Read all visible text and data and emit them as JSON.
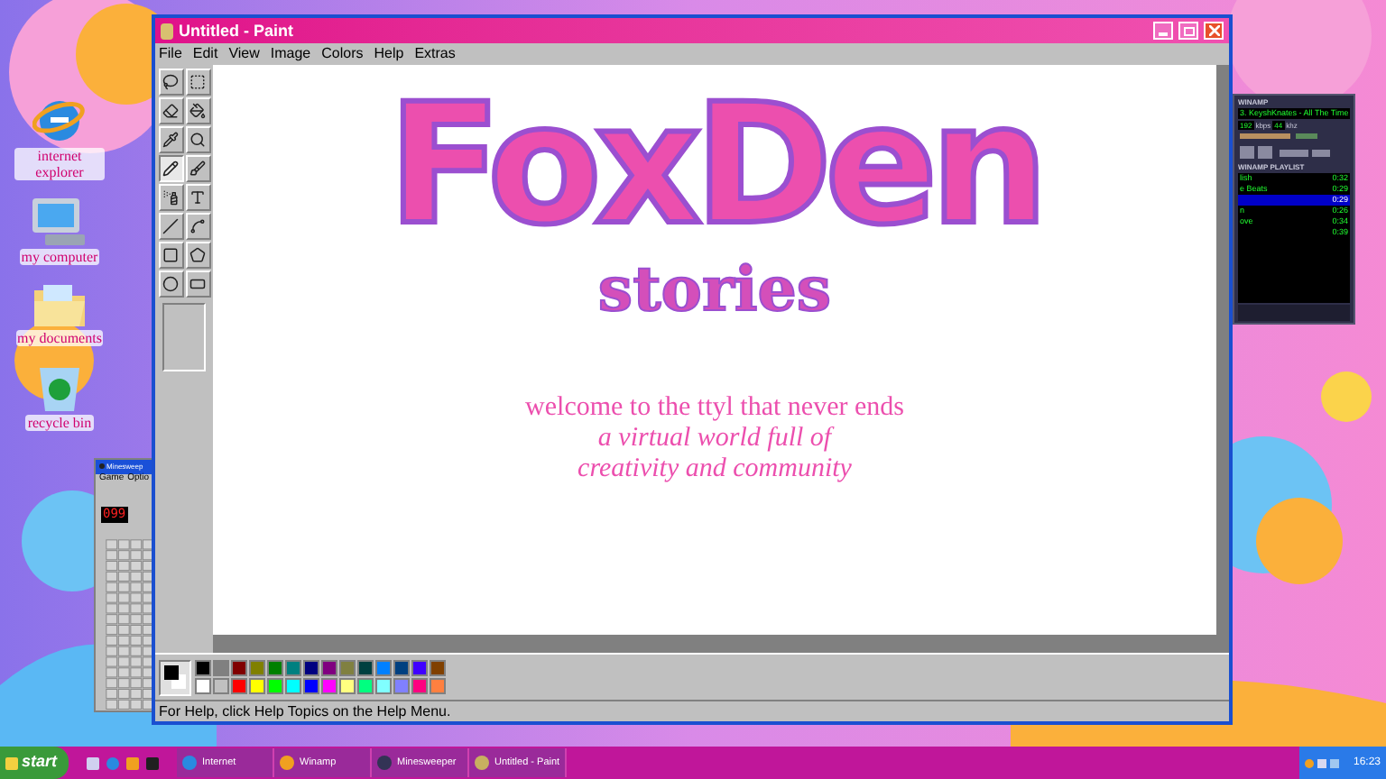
{
  "desktop": {
    "icons": [
      {
        "kind": "browser",
        "label": "internet explorer"
      },
      {
        "kind": "computer",
        "label": "my computer"
      },
      {
        "kind": "documents",
        "label": "my documents"
      },
      {
        "kind": "recycle",
        "label": "recycle bin"
      }
    ]
  },
  "minesweeper": {
    "title": "Minesweep",
    "menu": [
      "Game",
      "Optio"
    ],
    "counter": "099"
  },
  "paint": {
    "title": "Untitled - Paint",
    "menu": [
      "File",
      "Edit",
      "View",
      "Image",
      "Colors",
      "Help",
      "Extras"
    ],
    "tools": [
      {
        "kind": "free-select",
        "selected": false
      },
      {
        "kind": "select",
        "selected": false
      },
      {
        "kind": "eraser",
        "selected": false
      },
      {
        "kind": "fill",
        "selected": false
      },
      {
        "kind": "picker",
        "selected": false
      },
      {
        "kind": "magnifier",
        "selected": false
      },
      {
        "kind": "pencil",
        "selected": true
      },
      {
        "kind": "brush",
        "selected": false
      },
      {
        "kind": "airbrush",
        "selected": false
      },
      {
        "kind": "text",
        "selected": false
      },
      {
        "kind": "line",
        "selected": false
      },
      {
        "kind": "curve",
        "selected": false
      },
      {
        "kind": "rectangle",
        "selected": false
      },
      {
        "kind": "polygon",
        "selected": false
      },
      {
        "kind": "ellipse",
        "selected": false
      },
      {
        "kind": "rounded-rectangle",
        "selected": false
      }
    ],
    "canvas": {
      "logo": "FoxDen",
      "subtitle": "stories",
      "lines": [
        {
          "text": "welcome to the ttyl that never ends",
          "italic": false
        },
        {
          "text": "a virtual world full of",
          "italic": true
        },
        {
          "text": "creativity and community",
          "italic": true
        }
      ]
    },
    "palette": {
      "selector": [
        {
          "kind": "foreground",
          "color": "#000000"
        },
        {
          "kind": "background",
          "color": "#ffffff"
        }
      ],
      "colors": [
        {
          "color": "#000000"
        },
        {
          "color": "#808080"
        },
        {
          "color": "#800000"
        },
        {
          "color": "#808000"
        },
        {
          "color": "#008000"
        },
        {
          "color": "#008080"
        },
        {
          "color": "#000080"
        },
        {
          "color": "#800080"
        },
        {
          "color": "#808040"
        },
        {
          "color": "#004040"
        },
        {
          "color": "#0080ff"
        },
        {
          "color": "#004080"
        },
        {
          "color": "#4000ff"
        },
        {
          "color": "#804000"
        },
        {
          "color": "#ffffff"
        },
        {
          "color": "#c0c0c0"
        },
        {
          "color": "#ff0000"
        },
        {
          "color": "#ffff00"
        },
        {
          "color": "#00ff00"
        },
        {
          "color": "#00ffff"
        },
        {
          "color": "#0000ff"
        },
        {
          "color": "#ff00ff"
        },
        {
          "color": "#ffff80"
        },
        {
          "color": "#00ff80"
        },
        {
          "color": "#80ffff"
        },
        {
          "color": "#8080ff"
        },
        {
          "color": "#ff0080"
        },
        {
          "color": "#ff8040"
        }
      ]
    },
    "status": "For Help, click Help Topics on the Help Menu."
  },
  "winamp": {
    "title": "WINAMP",
    "track": "3. KeyshKnates - All The Time",
    "bitrate": "192",
    "bitrate_unit": "kbps",
    "samplerate": "44",
    "samplerate_unit": "khz",
    "playlist_title": "WINAMP PLAYLIST",
    "playlist": [
      {
        "title": "lish",
        "time": "0:32",
        "selected": false
      },
      {
        "title": "e Beats",
        "time": "0:29",
        "selected": false
      },
      {
        "time": "0:29",
        "selected": true
      },
      {
        "title": "n",
        "time": "0:26",
        "selected": false
      },
      {
        "title": "ove",
        "time": "0:34",
        "selected": false
      },
      {
        "time": "0:39",
        "selected": false
      }
    ]
  },
  "taskbar": {
    "start": "start",
    "tasks": [
      {
        "kind": "browser",
        "label": "Internet"
      },
      {
        "kind": "winamp",
        "label": "Winamp"
      },
      {
        "kind": "minesweeper",
        "label": "Minesweeper"
      },
      {
        "kind": "paint",
        "label": "Untitled - Paint"
      }
    ],
    "clock": "16:23"
  }
}
